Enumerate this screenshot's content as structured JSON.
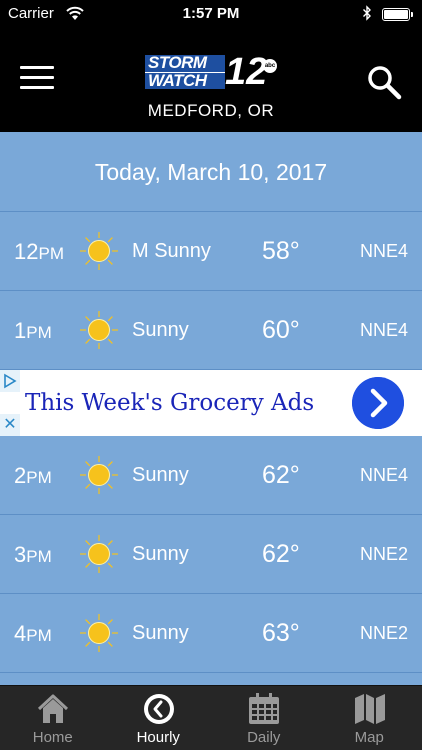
{
  "status_bar": {
    "carrier": "Carrier",
    "time": "1:57 PM"
  },
  "header": {
    "logo_line1": "STORM",
    "logo_line2": "WATCH",
    "logo_number": "12",
    "logo_network": "abc",
    "location": "MEDFORD, OR"
  },
  "forecast": {
    "date_label": "Today, March 10, 2017",
    "hours": [
      {
        "hour": "12",
        "period": "PM",
        "icon": "sun-icon",
        "condition": "M Sunny",
        "temp": "58°",
        "wind": "NNE4"
      },
      {
        "hour": "1",
        "period": "PM",
        "icon": "sun-icon",
        "condition": "Sunny",
        "temp": "60°",
        "wind": "NNE4"
      },
      {
        "hour": "2",
        "period": "PM",
        "icon": "sun-icon",
        "condition": "Sunny",
        "temp": "62°",
        "wind": "NNE4"
      },
      {
        "hour": "3",
        "period": "PM",
        "icon": "sun-icon",
        "condition": "Sunny",
        "temp": "62°",
        "wind": "NNE2"
      },
      {
        "hour": "4",
        "period": "PM",
        "icon": "sun-icon",
        "condition": "Sunny",
        "temp": "63°",
        "wind": "NNE2"
      }
    ]
  },
  "ad": {
    "text": "This Week's Grocery Ads",
    "close_glyph": "✕"
  },
  "tabs": [
    {
      "label": "Home",
      "icon": "home-icon",
      "active": false
    },
    {
      "label": "Hourly",
      "icon": "clock-icon",
      "active": true
    },
    {
      "label": "Daily",
      "icon": "calendar-icon",
      "active": false
    },
    {
      "label": "Map",
      "icon": "map-icon",
      "active": false
    }
  ],
  "colors": {
    "background": "#7aa8d8",
    "row_divider": "#5d8fc6",
    "sun": "#f6c21c",
    "ad_text": "#1a25b8",
    "ad_button": "#1f4fe0",
    "tab_bar": "#262626"
  }
}
